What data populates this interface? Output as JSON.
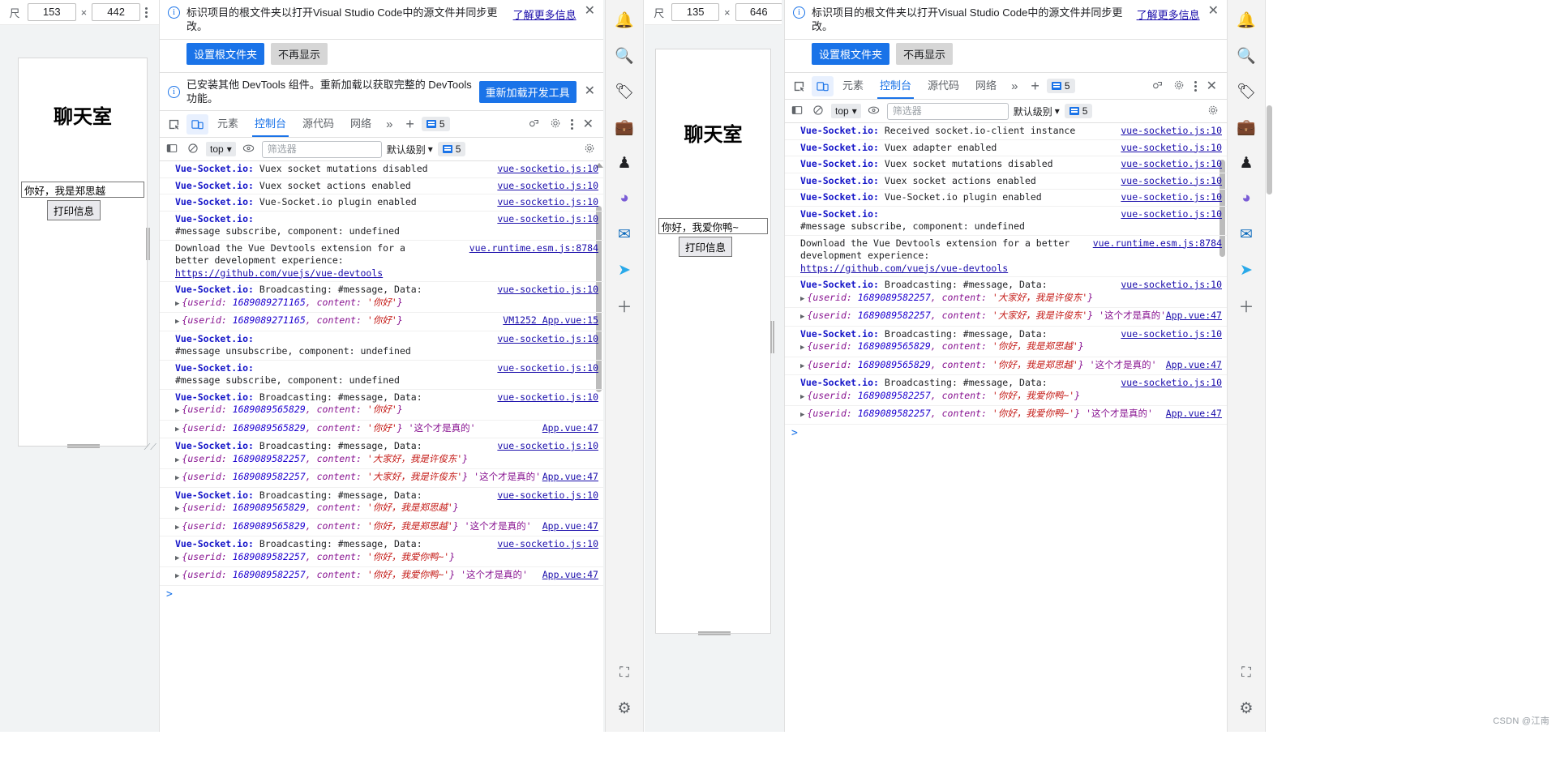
{
  "window_left": {
    "device_toolbar": {
      "ruler_icon": "ruler-icon",
      "width": "153",
      "height": "442",
      "x_sep": "×",
      "menu_icon": "kebab-menu-icon"
    },
    "page": {
      "title": "聊天室",
      "input_value": "你好，我是郑思越",
      "button_label": "打印信息"
    }
  },
  "devtools_left": {
    "notice1": {
      "icon": "info-icon",
      "text": "标识项目的根文件夹以打开Visual Studio Code中的源文件并同步更改。",
      "learn_more": "了解更多信息",
      "primary_button": "设置根文件夹",
      "secondary_button": "不再显示",
      "close_icon": "close-icon"
    },
    "notice2": {
      "icon": "info-icon",
      "text": "已安装其他 DevTools 组件。重新加载以获取完整的 DevTools 功能。",
      "reload_button": "重新加载开发工具",
      "close_icon": "close-icon"
    },
    "tabs": [
      {
        "label": "元素",
        "selected": false
      },
      {
        "label": "控制台",
        "selected": true
      },
      {
        "label": "源代码",
        "selected": false
      },
      {
        "label": "网络",
        "selected": false
      }
    ],
    "tab_overflow": "»",
    "tab_add": "+",
    "message_badge": "5",
    "console_toolbar": {
      "sidebar_icon": "console-sidebar-icon",
      "clear_icon": "clear-console-icon",
      "context": "top",
      "eye_icon": "live-expression-icon",
      "filter_placeholder": "筛选器",
      "level": "默认级别",
      "issues_badge": "5",
      "settings_icon": "gear-icon"
    },
    "console_lines": [
      {
        "prefix": "Vue-Socket.io:",
        "text": " Vuex socket mutations disabled",
        "link": "vue-socketio.js:10"
      },
      {
        "prefix": "Vue-Socket.io:",
        "text": " Vuex socket actions enabled",
        "link": "vue-socketio.js:10"
      },
      {
        "prefix": "Vue-Socket.io:",
        "text": " Vue-Socket.io plugin enabled",
        "link": "vue-socketio.js:10"
      },
      {
        "prefix": "Vue-Socket.io:",
        "text": "\n#message subscribe, component: undefined",
        "link": "vue-socketio.js:10"
      },
      {
        "prefix": "",
        "text": "Download the Vue Devtools extension for a\nbetter development experience:",
        "sublink": "https://github.com/vuejs/vue-devtools",
        "link": "vue.runtime.esm.js:8784"
      },
      {
        "prefix": "Vue-Socket.io:",
        "text": " Broadcasting: #message, Data:",
        "object": "{userid: 1689089271165, content: '你好'}",
        "link": "vue-socketio.js:10"
      },
      {
        "prefix": "",
        "object": "{userid: 1689089271165, content: '你好'}",
        "link": "VM1252 App.vue:15"
      },
      {
        "prefix": "Vue-Socket.io:",
        "text": "\n#message unsubscribe, component: undefined",
        "link": "vue-socketio.js:10"
      },
      {
        "prefix": "Vue-Socket.io:",
        "text": "\n#message subscribe, component: undefined",
        "link": "vue-socketio.js:10"
      },
      {
        "prefix": "Vue-Socket.io:",
        "text": " Broadcasting: #message, Data:",
        "object": "{userid: 1689089565829, content: '你好'}",
        "link": "vue-socketio.js:10"
      },
      {
        "prefix": "",
        "object": "{userid: 1689089565829, content: '你好'}",
        "suffix": "'这个才是真的'",
        "link": "App.vue:47"
      },
      {
        "prefix": "Vue-Socket.io:",
        "text": " Broadcasting: #message, Data:",
        "object": "{userid: 1689089582257, content: '大家好，我是许俊东'}",
        "link": "vue-socketio.js:10"
      },
      {
        "prefix": "",
        "object": "{userid: 1689089582257, content: '大家好，我是许俊东'}",
        "suffix": "'这个才是真的'",
        "link": "App.vue:47"
      },
      {
        "prefix": "Vue-Socket.io:",
        "text": " Broadcasting: #message, Data:",
        "object": "{userid: 1689089565829, content: '你好，我是郑思越'}",
        "link": "vue-socketio.js:10"
      },
      {
        "prefix": "",
        "object": "{userid: 1689089565829, content: '你好，我是郑思越'}",
        "suffix": "'这个才是真的'",
        "link": "App.vue:47"
      },
      {
        "prefix": "Vue-Socket.io:",
        "text": " Broadcasting: #message, Data:",
        "object": "{userid: 1689089582257, content: '你好，我爱你鸭~'}",
        "link": "vue-socketio.js:10"
      },
      {
        "prefix": "",
        "object": "{userid: 1689089582257, content: '你好，我爱你鸭~'}",
        "suffix": "'这个才是真的'",
        "link": "App.vue:47"
      }
    ],
    "prompt": ">"
  },
  "window_right": {
    "device_toolbar": {
      "ruler_icon": "ruler-icon",
      "width": "135",
      "height": "646",
      "x_sep": "×",
      "menu_icon": "kebab-menu-icon"
    },
    "page": {
      "title": "聊天室",
      "input_value": "你好，我爱你鸭~",
      "button_label": "打印信息"
    }
  },
  "devtools_right": {
    "notice1": {
      "icon": "info-icon",
      "text": "标识项目的根文件夹以打开Visual Studio Code中的源文件并同步更改。",
      "learn_more": "了解更多信息",
      "primary_button": "设置根文件夹",
      "secondary_button": "不再显示",
      "close_icon": "close-icon"
    },
    "tabs": [
      {
        "label": "元素",
        "selected": false
      },
      {
        "label": "控制台",
        "selected": true
      },
      {
        "label": "源代码",
        "selected": false
      },
      {
        "label": "网络",
        "selected": false
      }
    ],
    "tab_overflow": "»",
    "tab_add": "+",
    "message_badge": "5",
    "console_toolbar": {
      "context": "top",
      "filter_placeholder": "筛选器",
      "level": "默认级别",
      "issues_badge": "5",
      "settings_icon": "gear-icon"
    },
    "console_lines": [
      {
        "prefix": "Vue-Socket.io:",
        "text": " Received socket.io-client instance",
        "link": "vue-socketio.js:10"
      },
      {
        "prefix": "Vue-Socket.io:",
        "text": " Vuex adapter enabled",
        "link": "vue-socketio.js:10"
      },
      {
        "prefix": "Vue-Socket.io:",
        "text": " Vuex socket mutations disabled",
        "link": "vue-socketio.js:10"
      },
      {
        "prefix": "Vue-Socket.io:",
        "text": " Vuex socket actions enabled",
        "link": "vue-socketio.js:10"
      },
      {
        "prefix": "Vue-Socket.io:",
        "text": " Vue-Socket.io plugin enabled",
        "link": "vue-socketio.js:10"
      },
      {
        "prefix": "Vue-Socket.io:",
        "text": "\n#message subscribe, component: undefined",
        "link": "vue-socketio.js:10"
      },
      {
        "prefix": "",
        "text": "Download the Vue Devtools extension for a better\ndevelopment experience:",
        "sublink": "https://github.com/vuejs/vue-devtools",
        "link": "vue.runtime.esm.js:8784"
      },
      {
        "prefix": "Vue-Socket.io:",
        "text": " Broadcasting: #message, Data:",
        "object": "{userid: 1689089582257, content: '大家好，我是许俊东'}",
        "link": "vue-socketio.js:10"
      },
      {
        "prefix": "",
        "object": "{userid: 1689089582257, content: '大家好，我是许俊东'}",
        "suffix": "'这个才是真的'",
        "link": "App.vue:47"
      },
      {
        "prefix": "Vue-Socket.io:",
        "text": " Broadcasting: #message, Data:",
        "object": "{userid: 1689089565829, content: '你好，我是郑思越'}",
        "link": "vue-socketio.js:10"
      },
      {
        "prefix": "",
        "object": "{userid: 1689089565829, content: '你好，我是郑思越'}",
        "suffix": "'这个才是真的'",
        "link": "App.vue:47"
      },
      {
        "prefix": "Vue-Socket.io:",
        "text": " Broadcasting: #message, Data:",
        "object": "{userid: 1689089582257, content: '你好，我爱你鸭~'}",
        "link": "vue-socketio.js:10"
      },
      {
        "prefix": "",
        "object": "{userid: 1689089582257, content: '你好，我爱你鸭~'}",
        "suffix": "'这个才是真的'",
        "link": "App.vue:47"
      }
    ],
    "prompt": ">"
  },
  "sidebar_icons": [
    {
      "name": "bell-icon",
      "glyph": "🔔"
    },
    {
      "name": "search-icon",
      "glyph": "🔍"
    },
    {
      "name": "tag-icon",
      "glyph": "🏷"
    },
    {
      "name": "briefcase-icon",
      "glyph": "💼"
    },
    {
      "name": "chess-icon",
      "glyph": "♟"
    },
    {
      "name": "office-icon",
      "glyph": "◕"
    },
    {
      "name": "outlook-icon",
      "glyph": "✉"
    },
    {
      "name": "telegram-icon",
      "glyph": "➤"
    },
    {
      "name": "add-icon",
      "glyph": "＋"
    },
    {
      "name": "screenshot-icon",
      "glyph": "⬚"
    },
    {
      "name": "settings-icon",
      "glyph": "⚙"
    }
  ],
  "watermark": "CSDN @江南"
}
